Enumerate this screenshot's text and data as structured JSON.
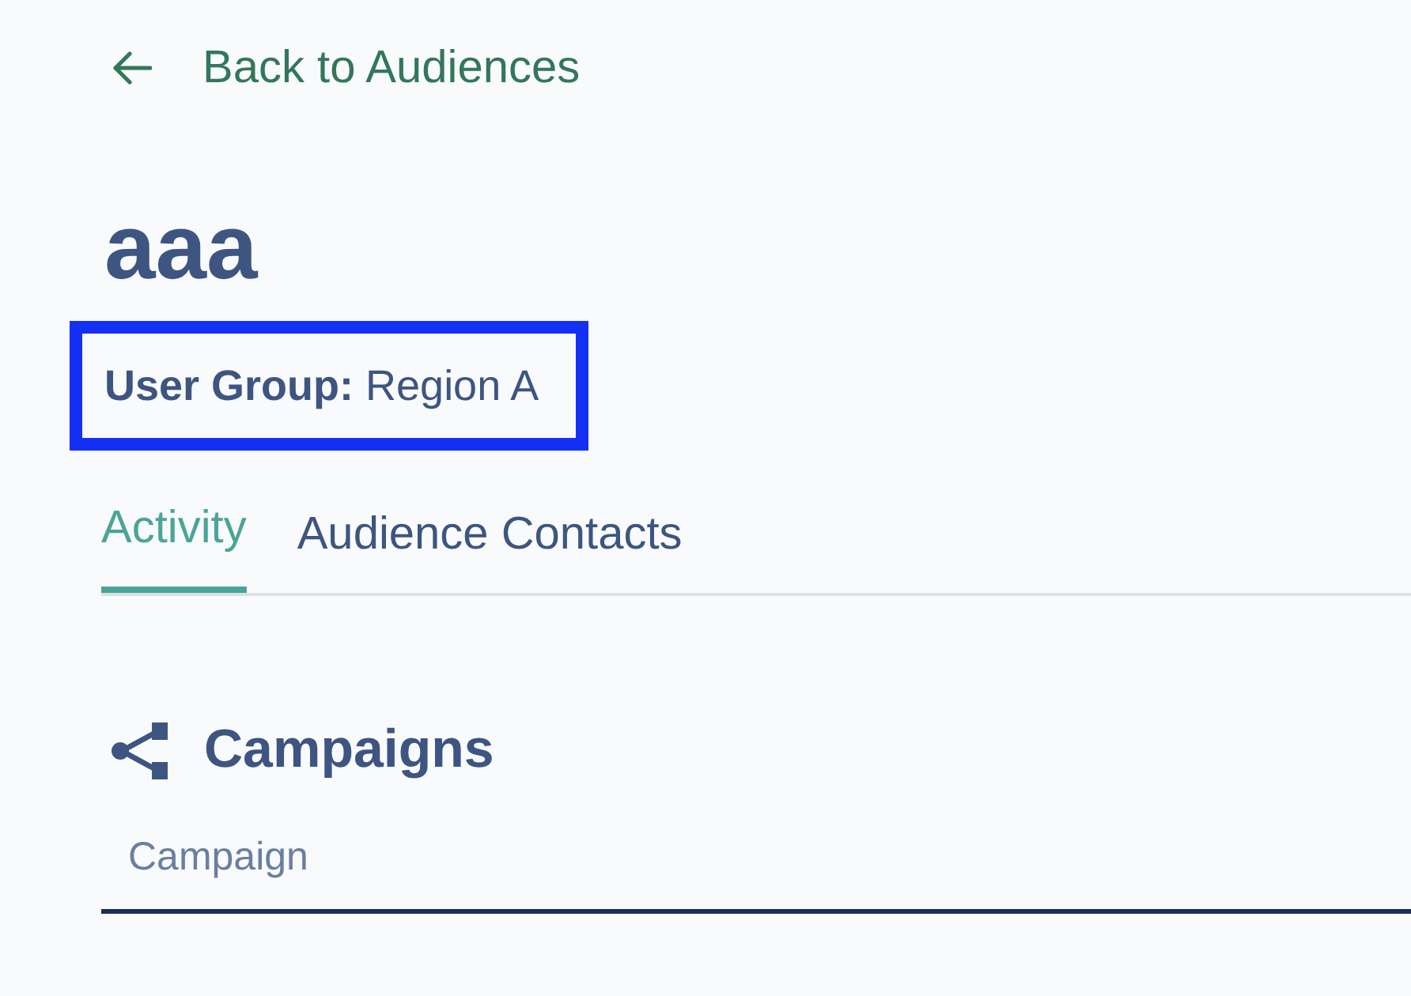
{
  "back_link": {
    "label": "Back to Audiences"
  },
  "title": "aaa",
  "user_group": {
    "text": "**User Group:** Region A",
    "highlighted": true
  },
  "tabs": [
    {
      "label": "Activity",
      "selected": true
    },
    {
      "label": "Audience Contacts",
      "selected": false
    }
  ],
  "section": {
    "title": "Campaigns",
    "table": {
      "columns": [
        "Campaign"
      ]
    }
  }
}
